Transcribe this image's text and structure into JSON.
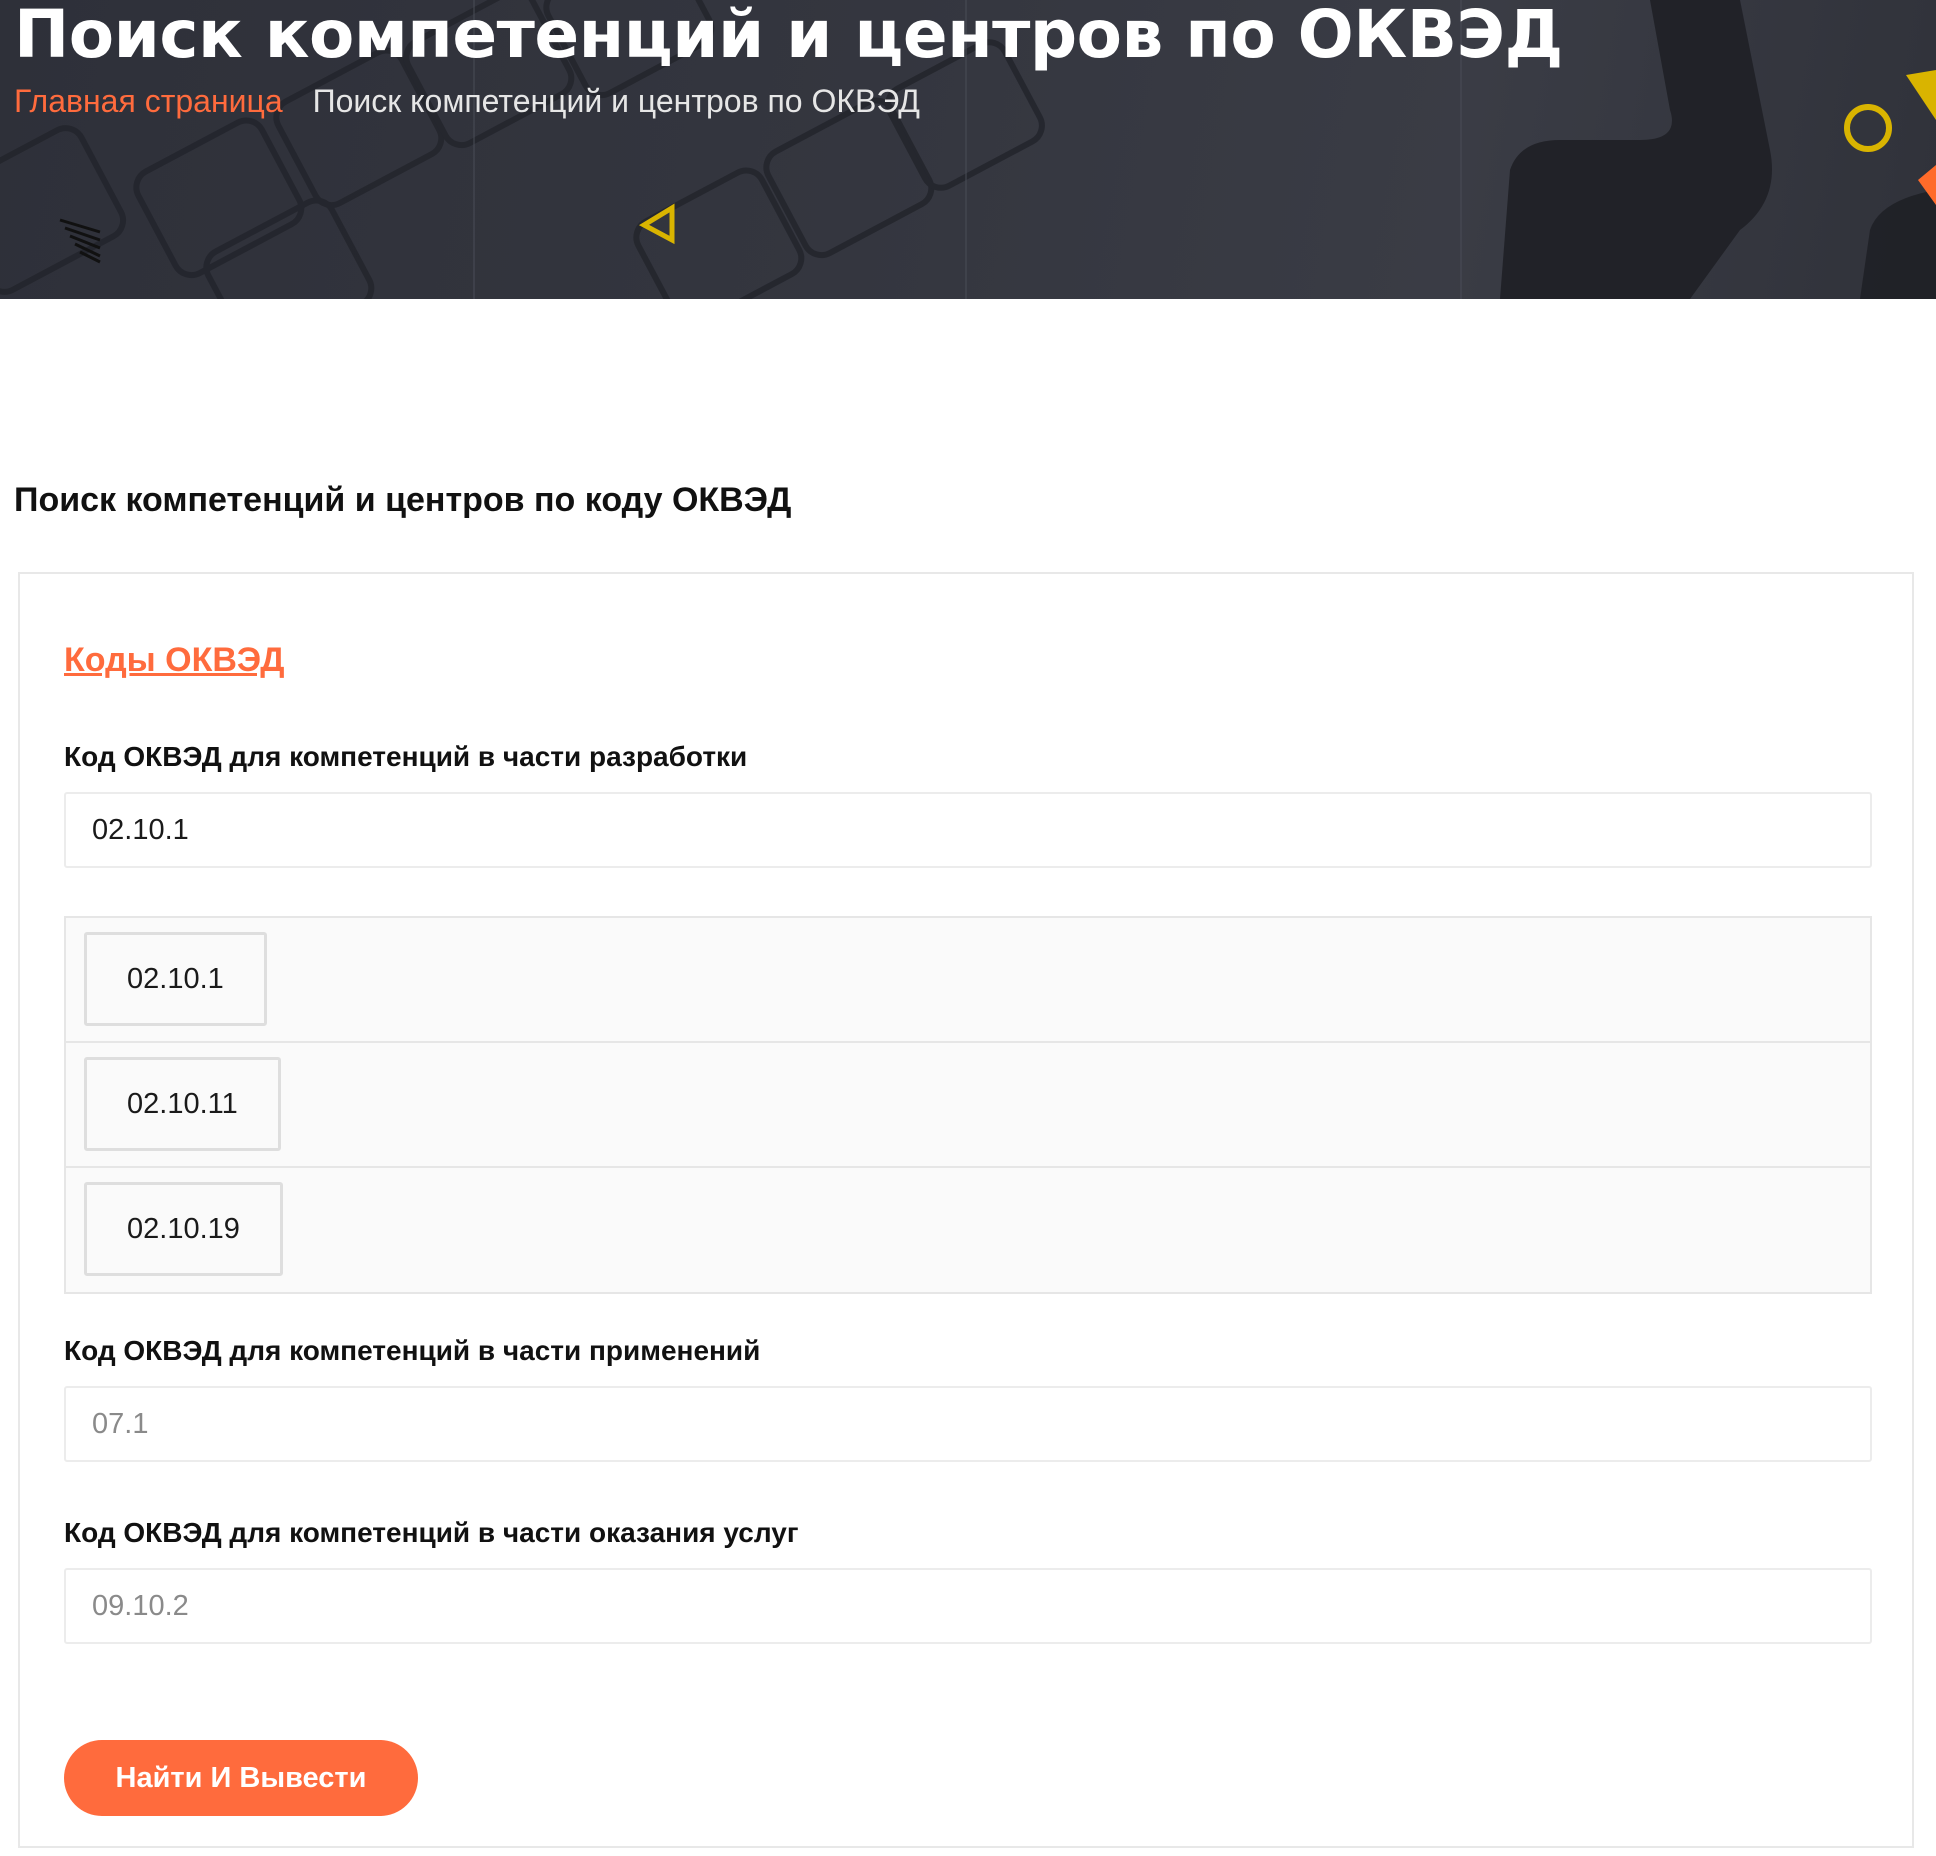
{
  "header": {
    "title": "Поиск компетенций и центров по ОКВЭД",
    "breadcrumb": {
      "home": "Главная страница",
      "current": "Поиск компетенций и центров по ОКВЭД"
    }
  },
  "main": {
    "section_title": "Поиск компетенций и центров по коду ОКВЭД",
    "okved_link": "Коды ОКВЭД",
    "fields": {
      "development": {
        "label": "Код ОКВЭД для компетенций в части разработки",
        "value": "02.10.1",
        "placeholder": ""
      },
      "suggestions": [
        "02.10.1",
        "02.10.11",
        "02.10.19"
      ],
      "applications": {
        "label": "Код ОКВЭД для компетенций в части применений",
        "value": "",
        "placeholder": "07.1"
      },
      "services": {
        "label": "Код ОКВЭД для компетенций в части оказания услуг",
        "value": "",
        "placeholder": "09.10.2"
      }
    },
    "submit_label": "Найти И Вывести"
  },
  "colors": {
    "accent": "#ff6b3d",
    "hero_bg": "#33353e",
    "hero_shape_yellow": "#d9b400",
    "hero_shape_orange": "#ff6b2a"
  }
}
